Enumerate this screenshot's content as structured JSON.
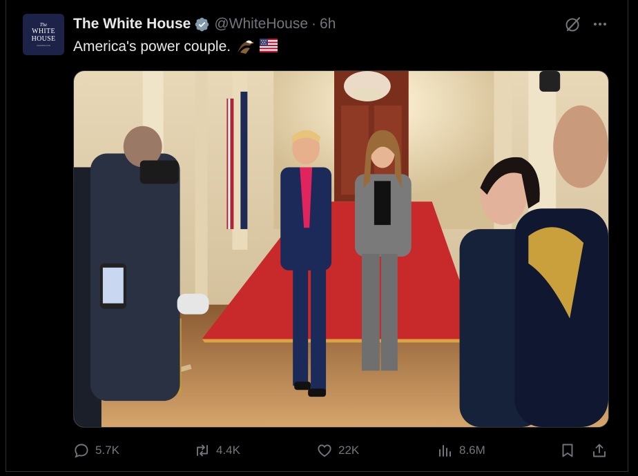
{
  "account": {
    "name": "The White House",
    "handle": "@WhiteHouse",
    "separator": "·",
    "time": "6h",
    "verified": true,
    "avatar": {
      "the": "The",
      "line1": "WHITE",
      "line2": "HOUSE",
      "sub": "WASHINGTON"
    }
  },
  "tweet": {
    "text": "America's power couple.",
    "emojis": [
      "eagle-emoji",
      "us-flag-emoji"
    ]
  },
  "header_icons": [
    "grok-icon",
    "more-icon"
  ],
  "actions": {
    "replies": "5.7K",
    "reposts": "4.4K",
    "likes": "22K",
    "views": "8.6M"
  },
  "colors": {
    "background": "#000000",
    "text": "#e7e9ea",
    "muted": "#71767b",
    "verified": "#829aab",
    "border": "#2f3336"
  }
}
